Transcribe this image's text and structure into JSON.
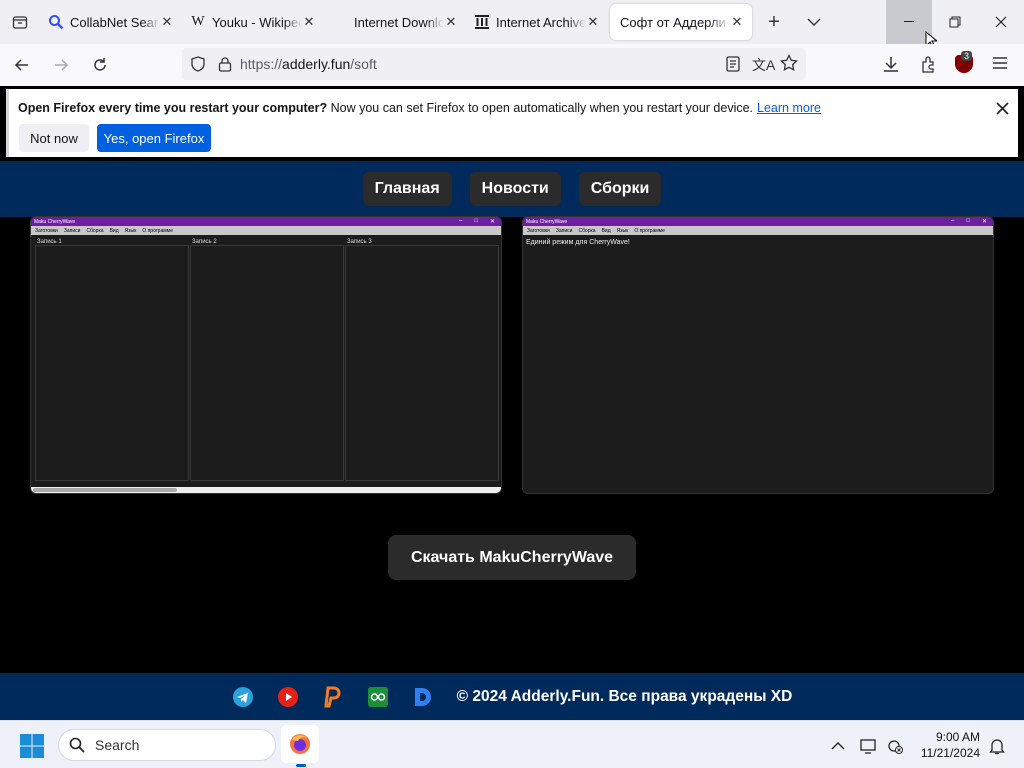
{
  "tabs": [
    {
      "title": "CollabNet SearX",
      "close": "✕"
    },
    {
      "title": "Youku - Wikipedia",
      "close": "✕"
    },
    {
      "title": "Internet Download",
      "close": "✕"
    },
    {
      "title": "Internet Archive",
      "close": "✕"
    },
    {
      "title": "Софт от Аддерли",
      "close": "✕"
    }
  ],
  "tab_icons": {
    "w": "W"
  },
  "url": {
    "prefix": "https://",
    "host": "adderly.fun",
    "path": "/soft"
  },
  "extension_badge": "3",
  "notification": {
    "bold": "Open Firefox every time you restart your computer?",
    "text": " Now you can set Firefox to open automatically when you restart your device.",
    "link": "Learn more",
    "not_now": "Not now",
    "open": "Yes, open Firefox"
  },
  "site_nav": [
    "Главная",
    "Новости",
    "Сборки"
  ],
  "shot1": {
    "title": "Maku CherryWave",
    "menu": [
      "Заготовки",
      "Записи",
      "Сборка",
      "Вид",
      "Язык",
      "О программе"
    ],
    "columns": [
      "Запись 1",
      "Запись 2",
      "Запись 3"
    ]
  },
  "shot2": {
    "title": "Maku CherryWave",
    "menu": [
      "Заготовки",
      "Записи",
      "Сборка",
      "Вид",
      "Язык",
      "О программе"
    ],
    "text": "Единий режим для CherryWave!"
  },
  "download_label": "Скачать MakuCherryWave",
  "footer_copy": "© 2024 Adderly.Fun. Все права украдены XD",
  "taskbar": {
    "search": "Search",
    "time": "9:00 AM",
    "date": "11/21/2024"
  },
  "colors": {
    "site_blue": "#002a5c",
    "accent": "#0061e0",
    "shot_titlebar": "#6e1fa0"
  }
}
